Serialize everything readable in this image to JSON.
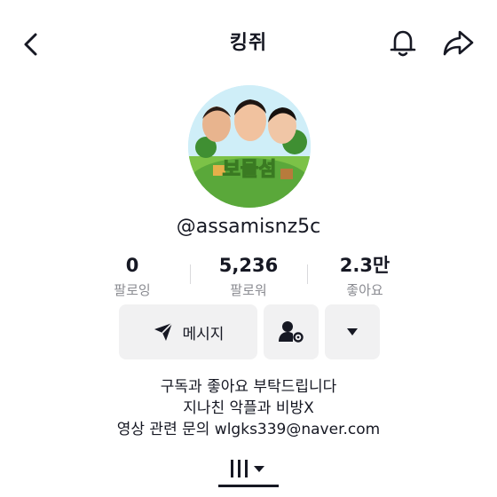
{
  "header": {
    "title": "킹쥐",
    "back_icon": "chevron-left-icon",
    "bell_icon": "bell-icon",
    "share_icon": "share-arrow-icon"
  },
  "profile": {
    "avatar_caption": "보물섬",
    "username": "@assamisnz5c"
  },
  "stats": {
    "following": {
      "value": "0",
      "label": "팔로잉"
    },
    "followers": {
      "value": "5,236",
      "label": "팔로워"
    },
    "likes": {
      "value": "2.3만",
      "label": "좋아요"
    }
  },
  "actions": {
    "message_label": "메시지",
    "message_icon": "send-icon",
    "friend_icon": "user-settings-icon",
    "more_icon": "caret-down-icon"
  },
  "bio": [
    "구독과 좋아요 부탁드립니다",
    "지나친 악플과 비방X",
    "영상 관련 문의 wlgks339@naver.com"
  ],
  "tabs": {
    "videos_icon": "grid-lines-icon"
  },
  "colors": {
    "text": "#161823",
    "muted": "#8a8b91",
    "button_bg": "#f1f1f2"
  }
}
